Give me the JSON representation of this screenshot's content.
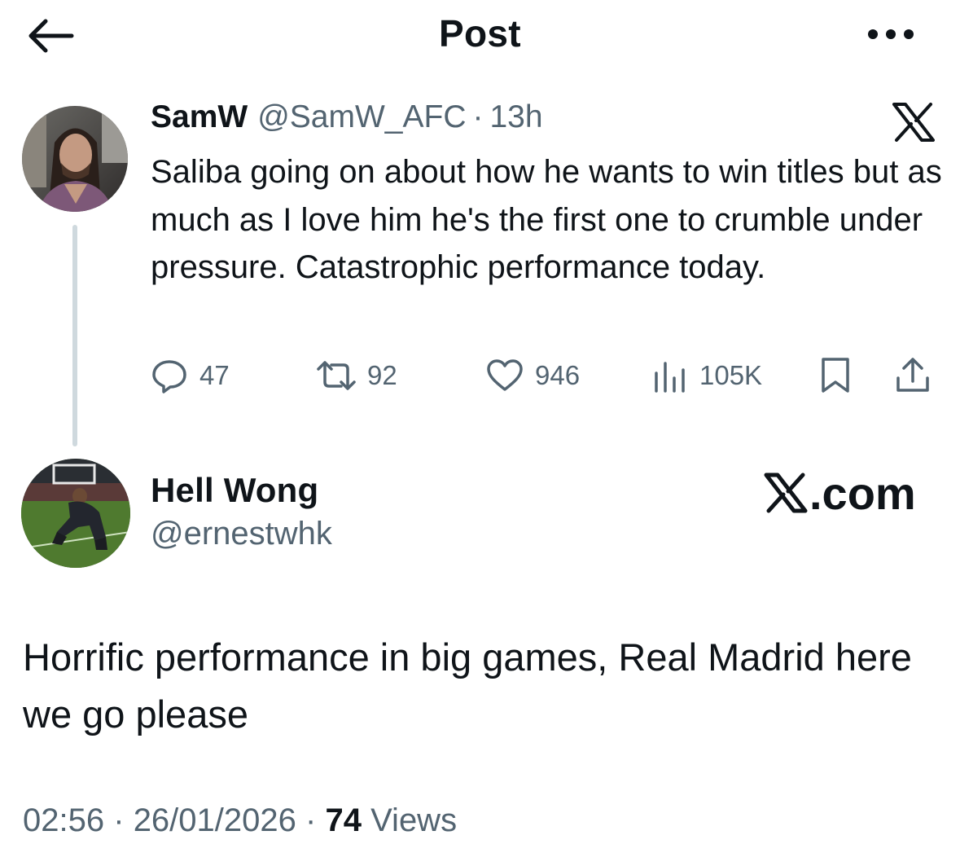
{
  "header": {
    "title": "Post",
    "back_icon": "arrow-left-icon",
    "more_icon": "more-horizontal-icon"
  },
  "quoted_post": {
    "author_name": "SamW",
    "handle": "@SamW_AFC",
    "separator": "·",
    "age": "13h",
    "platform_icon": "x-logo-icon",
    "text": "Saliba going on about how he wants to win titles but as much as I love him he's the first one to crumble under pressure. Catastrophic performance today.",
    "actions": {
      "replies": "47",
      "reposts": "92",
      "likes": "946",
      "views": "105K"
    }
  },
  "main_post": {
    "author_name": "Hell Wong",
    "handle": "@ernestwhk",
    "watermark": ".com",
    "text": "Horrific performance in big games, Real Madrid here we go please",
    "time": "02:56",
    "date": "26/01/2026",
    "separator": "·",
    "views_count": "74",
    "views_label": "Views"
  },
  "colors": {
    "text": "#0f1419",
    "secondary": "#536471",
    "thread_line": "#cfd9de",
    "background": "#ffffff"
  }
}
